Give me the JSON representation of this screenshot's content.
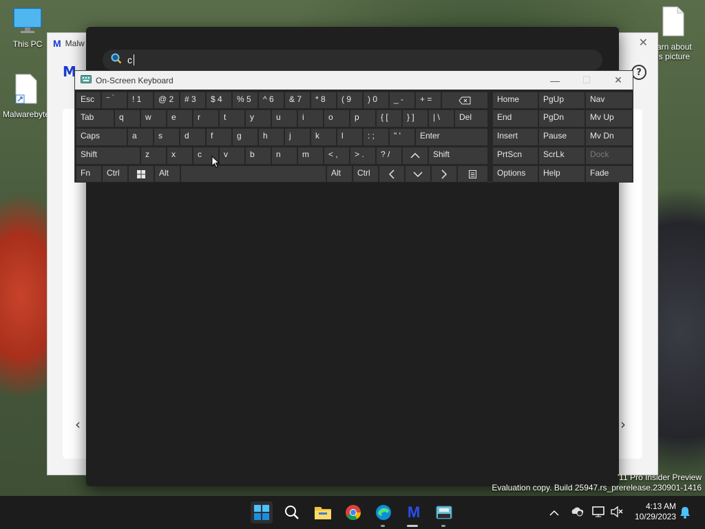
{
  "desktop": {
    "icons": [
      {
        "label": "This PC",
        "icon": "monitor-icon"
      },
      {
        "label": "Malwarebyte",
        "icon": "shortcut-file-icon"
      },
      {
        "label_line1": "arn about",
        "label_line2": "is picture",
        "icon": "file-icon"
      }
    ]
  },
  "malwarebytes_window": {
    "title": "Malw",
    "help": "?"
  },
  "search": {
    "query": "c"
  },
  "osk": {
    "title": "On-Screen Keyboard",
    "rows": {
      "row1": [
        "Esc",
        "~ `",
        "! 1",
        "@ 2",
        "# 3",
        "$ 4",
        "% 5",
        "^ 6",
        "& 7",
        "* 8",
        "( 9",
        ") 0",
        "_ -",
        "+ ="
      ],
      "row2": [
        "Tab",
        "q",
        "w",
        "e",
        "r",
        "t",
        "y",
        "u",
        "i",
        "o",
        "p",
        "{ [",
        "} ]",
        "| \\",
        "Del"
      ],
      "row3": [
        "Caps",
        "a",
        "s",
        "d",
        "f",
        "g",
        "h",
        "j",
        "k",
        "l",
        ": ;",
        "\" '",
        "Enter"
      ],
      "row4": [
        "Shift",
        "z",
        "x",
        "c",
        "v",
        "b",
        "n",
        "m",
        "< ,",
        "> .",
        "? /",
        "Shift"
      ],
      "row5": [
        "Fn",
        "Ctrl",
        "Alt",
        "Alt",
        "Ctrl"
      ],
      "nav": [
        "Home",
        "PgUp",
        "Nav",
        "End",
        "PgDn",
        "Mv Up",
        "Insert",
        "Pause",
        "Mv Dn",
        "PrtScn",
        "ScrLk",
        "Dock",
        "Options",
        "Help",
        "Fade"
      ]
    }
  },
  "watermark": {
    "line1": "'11 Pro Insider Preview",
    "line2": "Evaluation copy. Build 25947.rs_prerelease.230901-1416"
  },
  "clock": {
    "time": "4:13 AM",
    "date": "10/29/2023"
  },
  "colors": {
    "accent": "#0078d4",
    "osk_key": "#3a3a3a",
    "osk_bg": "#262626",
    "taskbar": "#1c1c1c"
  }
}
